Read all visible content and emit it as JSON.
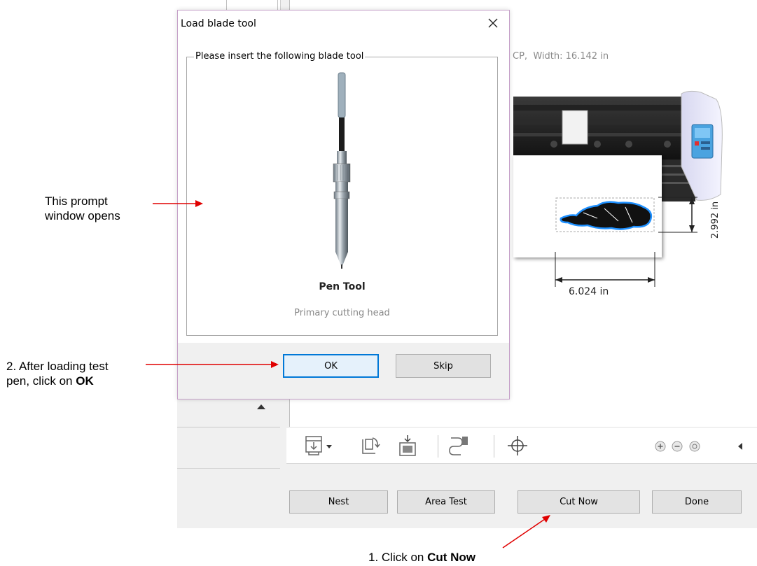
{
  "app": {
    "material_info": "CP,  Width: 16.142 in",
    "dim_width": "6.024 in",
    "dim_height": "2.992 in",
    "buttons": {
      "nest": "Nest",
      "area_test": "Area Test",
      "cut_now": "Cut Now",
      "done": "Done"
    },
    "toolbar_icons": [
      "output-icon",
      "dropdown-arrow-icon",
      "rotate-icon",
      "place-icon",
      "weed-icon",
      "crosshair-icon",
      "zoom-in-icon",
      "zoom-out-icon",
      "fit-icon",
      "scroll-left-icon"
    ]
  },
  "dialog": {
    "title": "Load blade tool",
    "group_label": "Please insert the following blade tool",
    "tool_name": "Pen Tool",
    "tool_desc": "Primary cutting head",
    "ok_label": "OK",
    "skip_label": "Skip"
  },
  "annotations": {
    "prompt_line1": "This prompt",
    "prompt_line2": "window opens",
    "step2_line1": "2. After loading test",
    "step2_prefix": "pen, click on ",
    "step2_bold": "OK",
    "step1_prefix": "1. Click on ",
    "step1_bold": "Cut Now"
  },
  "colors": {
    "accent": "#0078d7",
    "annotation_arrow": "#e00000",
    "dialog_border": "#c5a0c8",
    "design_outline": "#1e90ff"
  }
}
